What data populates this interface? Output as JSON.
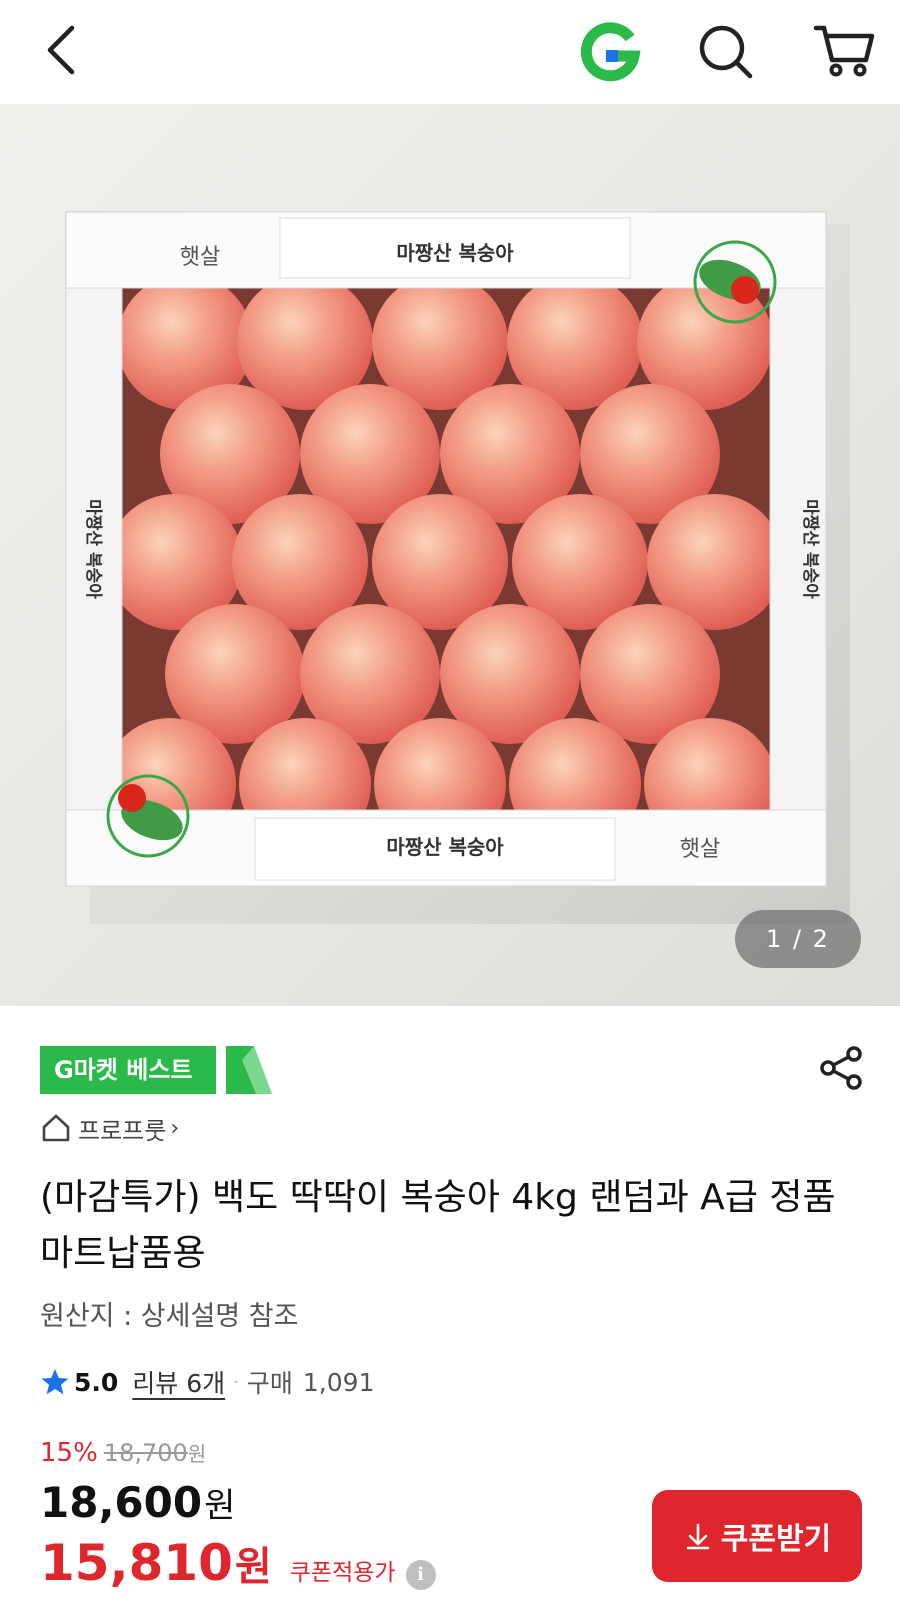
{
  "header": {
    "back_icon": "chevron-left-icon",
    "logo_letter": "G",
    "logo_color": "#2bb94a",
    "logo_accent": "#1a73e8",
    "search_icon": "search-icon",
    "cart_icon": "cart-icon"
  },
  "image": {
    "counter": "1 / 2",
    "box_label_top": "마짱산 복숭아",
    "box_label_bottom": "마짱산 복숭아",
    "box_side_label": "마짱산 복숭아",
    "brand_script": "햇살"
  },
  "badge": {
    "label": "G마켓 베스트",
    "color": "#2bb94a"
  },
  "seller": {
    "name": "프로프룻",
    "chevron": "›"
  },
  "product": {
    "title": "(마감특가) 백도 딱딱이 복숭아 4kg 랜덤과 A급 정품 마트납품용",
    "origin": "원산지 : 상세설명 참조"
  },
  "rating": {
    "score": "5.0",
    "review_link": "리뷰 6개",
    "dot": "·",
    "purchase_label": "구매",
    "purchase_count": "1,091"
  },
  "price": {
    "discount_rate": "15%",
    "original": "18,700",
    "original_unit": "원",
    "sale": "18,600",
    "sale_unit": "원",
    "coupon_price": "15,810",
    "coupon_unit": "원",
    "coupon_label": "쿠폰적용가",
    "info_symbol": "i"
  },
  "coupon_button": {
    "label": "쿠폰받기",
    "color": "#e0262d"
  }
}
